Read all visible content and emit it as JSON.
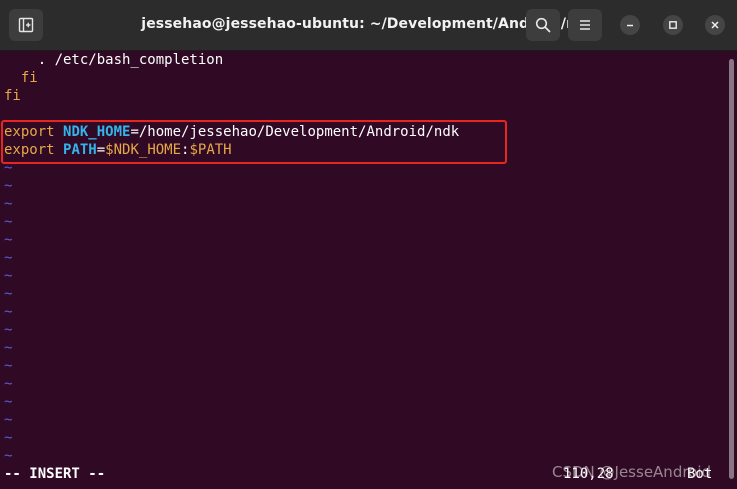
{
  "window": {
    "title": "jessehao@jessehao-ubuntu: ~/Development/Android/ndk",
    "new_tab_icon": "new-tab-icon",
    "search_icon": "search-icon",
    "menu_icon": "hamburger-menu-icon",
    "minimize_icon": "minimize-icon",
    "maximize_icon": "maximize-icon",
    "close_icon": "close-icon"
  },
  "editor": {
    "lines": [
      {
        "text": "    . /etc/bash_completion"
      },
      {
        "text": "  fi"
      },
      {
        "text": "fi"
      },
      {
        "text": ""
      }
    ],
    "export_lines": [
      {
        "keyword": "export",
        "name": "NDK_HOME",
        "value": "=/home/jessehao/Development/Android/ndk"
      },
      {
        "keyword": "export",
        "name": "PATH",
        "value_prefix": "=",
        "ref1": "$NDK_HOME",
        "sep": ":",
        "ref2": "$PATH"
      }
    ],
    "tilde_char": "~",
    "tilde_count": 17
  },
  "status": {
    "mode": "-- INSERT --",
    "position": "110,28",
    "scroll": "Bot"
  },
  "watermark": "CSDN @JesseAndroid",
  "colors": {
    "background": "#300a24",
    "titlebar": "#2c2c2c",
    "keyword": "#e6a847",
    "variable": "#34b4eb",
    "tilde": "#5a5ad6",
    "highlight_border": "#e8261f"
  }
}
